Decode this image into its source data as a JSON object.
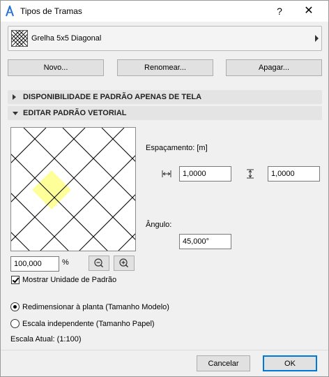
{
  "window": {
    "title": "Tipos de Tramas",
    "help_label": "?",
    "close_label": "✕"
  },
  "pattern_selector": {
    "selected_name": "Grelha 5x5 Diagonal"
  },
  "actions": {
    "new_label": "Novo...",
    "rename_label": "Renomear...",
    "delete_label": "Apagar..."
  },
  "sections": {
    "availability": "DISPONIBILIDADE E PADRÃO APENAS DE TELA",
    "edit_vector": "EDITAR PADRÃO VETORIAL"
  },
  "preview": {
    "zoom_value": "100,000",
    "zoom_unit": "%",
    "highlight_color": "#ffff99"
  },
  "options": {
    "show_unit_label": "Mostrar Unidade de Padrão",
    "show_unit_checked": true
  },
  "spacing": {
    "label": "Espaçamento: [m]",
    "horizontal_value": "1,0000",
    "vertical_value": "1,0000"
  },
  "angle": {
    "label": "Ângulo:",
    "value": "45,000°"
  },
  "scaling": {
    "option_model": "Redimensionar à planta (Tamanho Modelo)",
    "option_paper": "Escala independente (Tamanho Papel)",
    "selected": "model",
    "current_scale": "Escala Atual: (1:100)"
  },
  "footer": {
    "cancel_label": "Cancelar",
    "ok_label": "OK"
  }
}
